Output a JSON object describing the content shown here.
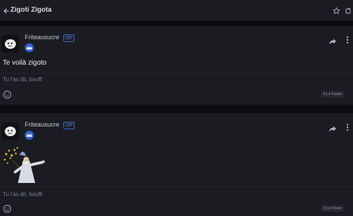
{
  "header": {
    "title": "Zigoti Zigota"
  },
  "posts": [
    {
      "author": "Friteausucre",
      "badge": "OP",
      "body": "Te voilà zigoto",
      "signature": "Tu l'as dit, bouffi",
      "time": "il y a 4 jours"
    },
    {
      "author": "Friteausucre",
      "badge": "OP",
      "signature": "Tu l'as dit, bouffi",
      "time": "il y a 4 jours"
    }
  ],
  "colors": {
    "background": "#0b0c0f",
    "surface": "#1a1c21",
    "accent": "#3b6fd6",
    "crown_badge": "#2f5fd0"
  },
  "icons": {
    "back": "arrow-left-icon",
    "favorite": "star-icon",
    "refresh": "refresh-icon",
    "share": "share-icon",
    "more": "more-vertical-icon",
    "react": "emoji-add-icon",
    "crown": "crown-icon",
    "avatar": "ghost-avatar-icon"
  }
}
